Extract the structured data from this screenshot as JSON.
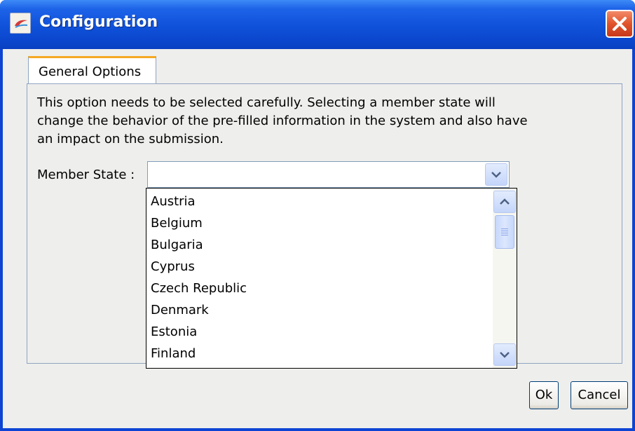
{
  "window": {
    "title": "Configuration",
    "app_icon": "app-logo-icon",
    "close_icon": "close-icon"
  },
  "tabs": [
    {
      "label": "General Options",
      "selected": true
    }
  ],
  "panel": {
    "description": "This option needs to be selected carefully. Selecting a member state will change the behavior of the pre-filled information in the system and also have an impact on the submission.",
    "member_state_label": "Member State :",
    "member_state_value": ""
  },
  "dropdown": {
    "items": [
      "Austria",
      "Belgium",
      "Bulgaria",
      "Cyprus",
      "Czech Republic",
      "Denmark",
      "Estonia",
      "Finland"
    ]
  },
  "buttons": {
    "ok": "Ok",
    "cancel": "Cancel"
  },
  "colors": {
    "titlebar": "#0a46cc",
    "tab_accent": "#f5a823",
    "close_button": "#e0532b"
  }
}
